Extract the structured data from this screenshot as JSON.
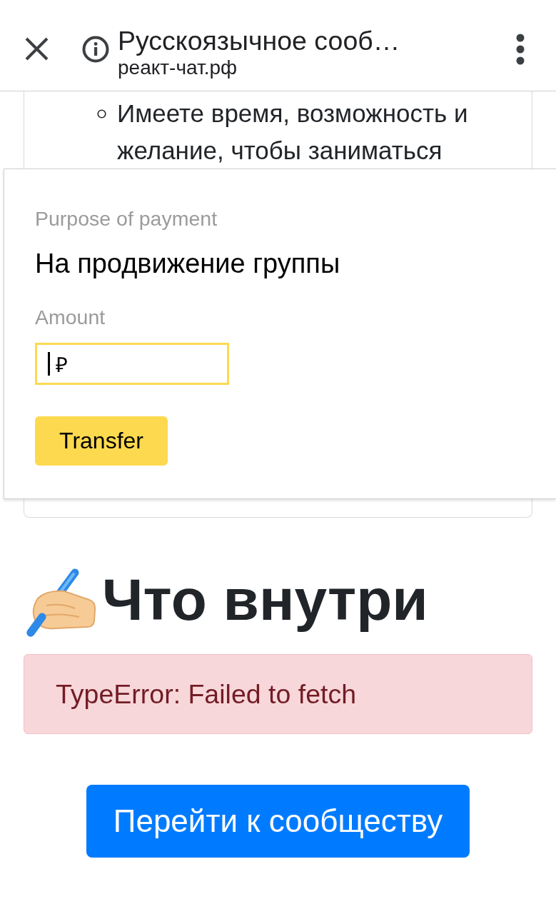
{
  "top_bar": {
    "title": "Русскоязычное сооб…",
    "url": "реакт-чат.рф"
  },
  "card": {
    "list_items": [
      {
        "text": "Имеете время, возможность и желание, чтобы заниматься"
      }
    ]
  },
  "payment_widget": {
    "purpose_label": "Purpose of payment",
    "purpose": "На продвижение группы",
    "amount_label": "Amount",
    "amount_field": {
      "currency": "₽",
      "focused": true
    },
    "transfer_button": "Transfer"
  },
  "heading": {
    "text": "Что внутри"
  },
  "error_alert": {
    "message": "TypeError: Failed to fetch"
  },
  "community_button": {
    "label": "Перейти к сообществу"
  }
}
